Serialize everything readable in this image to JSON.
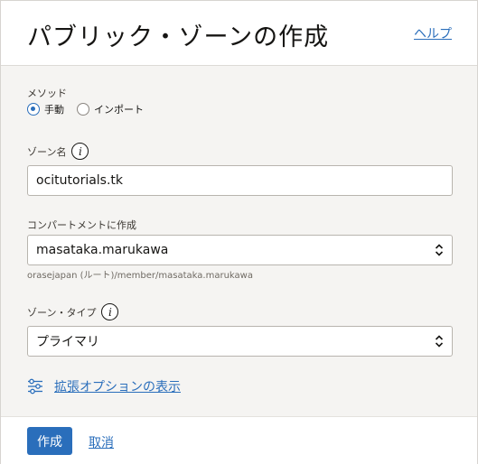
{
  "header": {
    "title": "パブリック・ゾーンの作成",
    "help_label": "ヘルプ"
  },
  "method": {
    "label": "メソッド",
    "options": [
      {
        "label": "手動",
        "selected": true
      },
      {
        "label": "インポート",
        "selected": false
      }
    ]
  },
  "zone_name": {
    "label": "ゾーン名",
    "value": "ocitutorials.tk",
    "info_icon": "info-icon"
  },
  "compartment": {
    "label": "コンパートメントに作成",
    "value": "masataka.marukawa",
    "path": "orasejapan (ルート)/member/masataka.marukawa"
  },
  "zone_type": {
    "label": "ゾーン・タイプ",
    "value": "プライマリ",
    "info_icon": "info-icon"
  },
  "advanced": {
    "label": "拡張オプションの表示",
    "icon": "sliders-icon"
  },
  "footer": {
    "create_label": "作成",
    "cancel_label": "取消"
  },
  "colors": {
    "accent": "#2a6ebb",
    "body_bg": "#f5f4f2",
    "text": "#161513"
  }
}
